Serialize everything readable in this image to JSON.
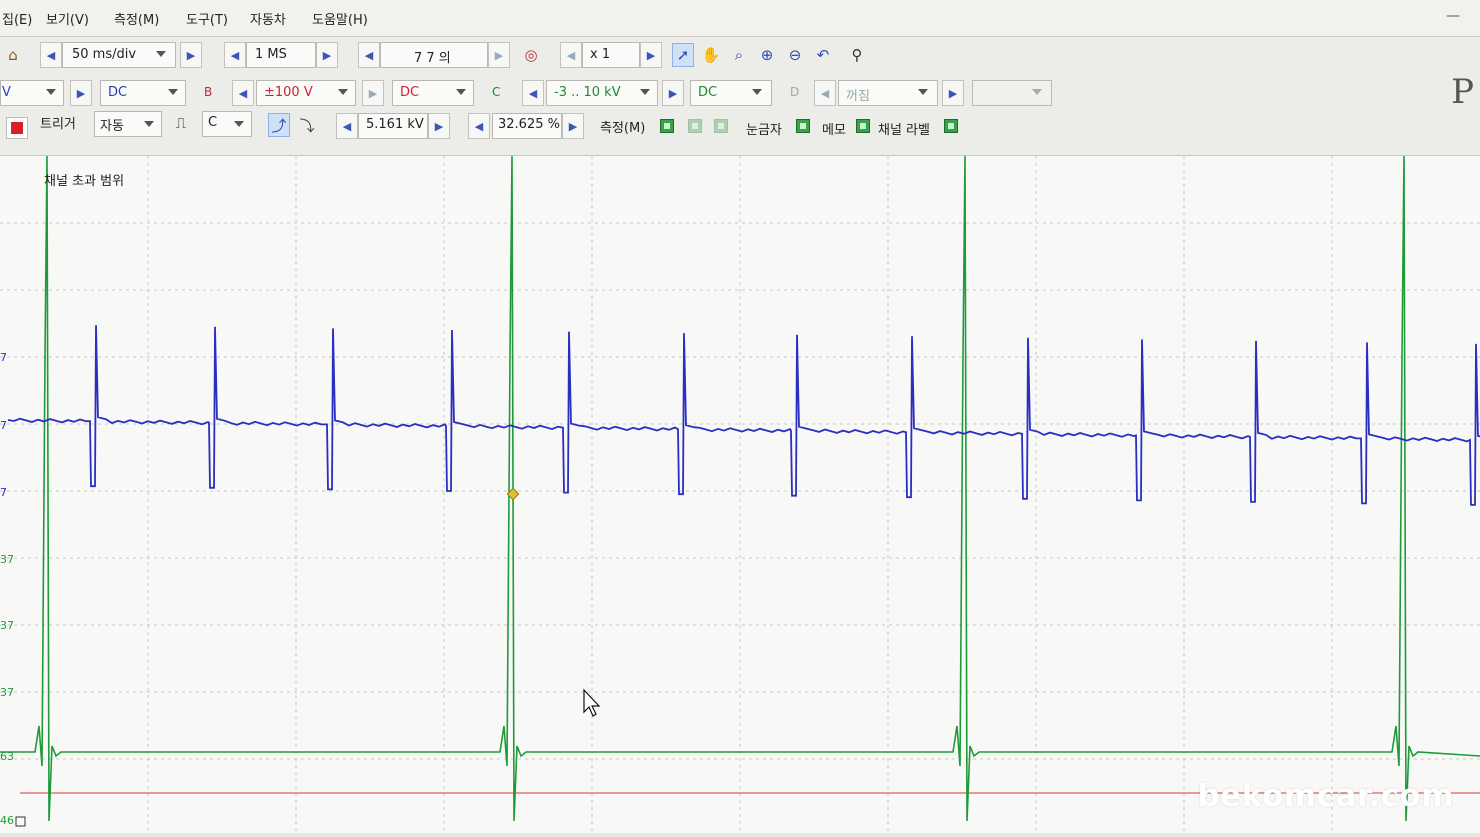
{
  "menu": [
    "집(E)",
    "보기(V)",
    "측정(M)",
    "도구(T)",
    "자동차",
    "도움말(H)"
  ],
  "toolbar1": {
    "timebase": "50 ms/div",
    "samples": "1 MS",
    "captures": "7 7 의",
    "zoom": "x 1"
  },
  "toolbar2": {
    "chA_range": "V",
    "chA_coupling": "DC",
    "chB_label": "B",
    "chB_range": "±100 V",
    "chB_coupling": "DC",
    "chC_label": "C",
    "chC_range": "-3 .. 10 kV",
    "chC_coupling": "DC",
    "chD_label": "D",
    "chD_range": "꺼짐"
  },
  "toolbar3": {
    "trigger_label": "트리거",
    "trigger_mode": "자동",
    "trigger_channel": "C",
    "trigger_level": "5.161 kV",
    "pretrigger": "32.625 %",
    "measure_label": "측정(M)",
    "rulers_label": "눈금자",
    "notes_label": "메모",
    "channel_labels_label": "채널 라벨"
  },
  "scope": {
    "overrange_text": "채널 초과 범위",
    "axis_labels": [
      "7",
      "7",
      "7",
      "37",
      "37",
      "37",
      "63",
      "46"
    ],
    "grid": true
  },
  "colors": {
    "channel_blue": "#2a2fc0",
    "channel_green": "#1f9a3a",
    "trigger_marker": "#e0c030",
    "ref_line": "#d23a3a",
    "grid": "#c8c8c8"
  },
  "icons": [
    "home-icon",
    "pointer-icon",
    "hand-icon",
    "zoom-icon",
    "zoom-in-icon",
    "zoom-out-icon",
    "undo-icon",
    "zoom-fit-icon",
    "stop-icon"
  ],
  "watermark": "bekomcar.com",
  "logo_letter": "P"
}
